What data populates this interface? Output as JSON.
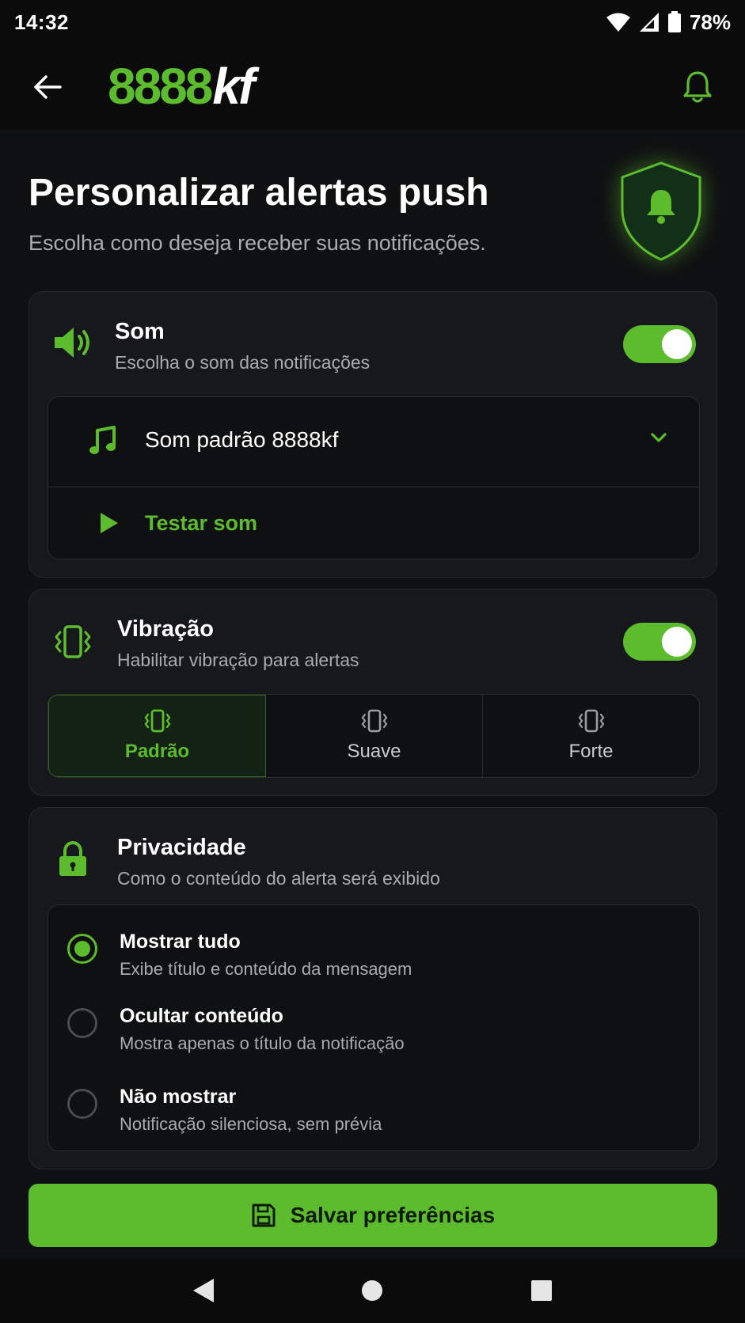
{
  "status": {
    "time": "14:32",
    "battery": "78%"
  },
  "app_bar": {
    "logo_green": "8888",
    "logo_white": "kf"
  },
  "header": {
    "title": "Personalizar alertas push",
    "subtitle": "Escolha como deseja receber suas notificações."
  },
  "sound": {
    "title": "Som",
    "description": "Escolha o som das notificações",
    "enabled": true,
    "selected": "Som padrão 8888kf",
    "test_label": "Testar som"
  },
  "vibration": {
    "title": "Vibração",
    "description": "Habilitar vibração para alertas",
    "enabled": true,
    "options": [
      {
        "label": "Padrão",
        "active": true
      },
      {
        "label": "Suave",
        "active": false
      },
      {
        "label": "Forte",
        "active": false
      }
    ]
  },
  "privacy": {
    "title": "Privacidade",
    "description": "Como o conteúdo do alerta será exibido",
    "options": [
      {
        "title": "Mostrar tudo",
        "desc": "Exibe título e conteúdo da mensagem",
        "selected": true
      },
      {
        "title": "Ocultar conteúdo",
        "desc": "Mostra apenas o título da notificação",
        "selected": false
      },
      {
        "title": "Não mostrar",
        "desc": "Notificação silenciosa, sem prévia",
        "selected": false
      }
    ]
  },
  "save_button": {
    "label": "Salvar preferências"
  },
  "colors": {
    "accent": "#5dbb2e",
    "background": "#0f1012",
    "card": "#17181b"
  }
}
